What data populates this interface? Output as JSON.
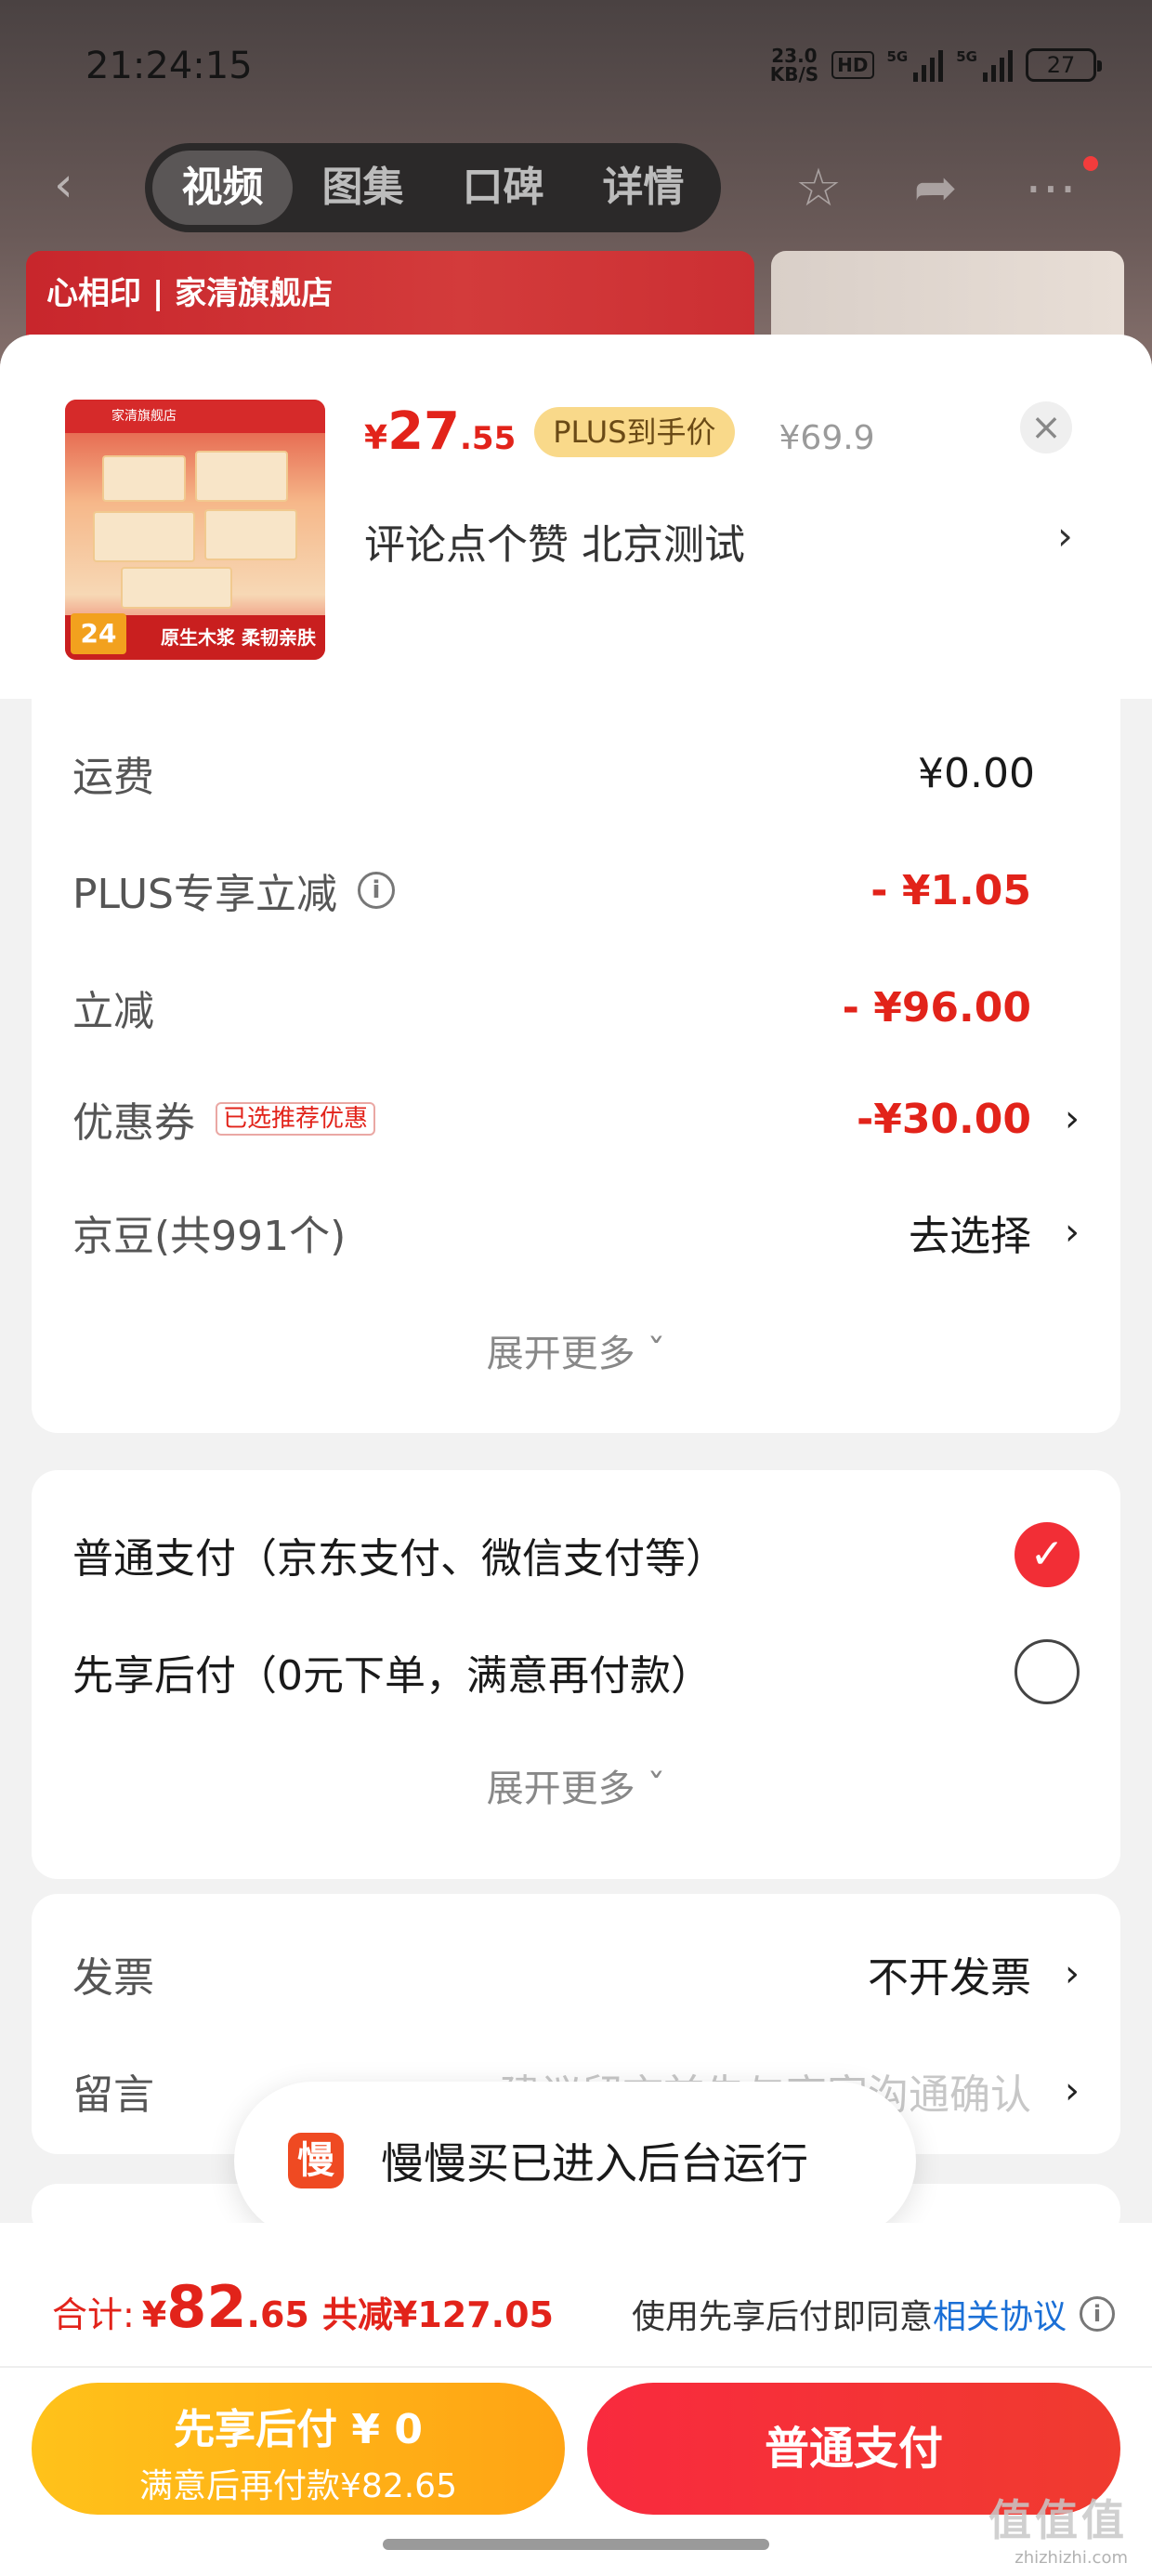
{
  "status_bar": {
    "time": "21:24:15",
    "net_speed_value": "23.0",
    "net_speed_unit": "KB/S",
    "hd_badge": "HD",
    "signal_1_label": "5G",
    "signal_2_label": "5G",
    "battery_level": "27"
  },
  "nav": {
    "tabs": [
      {
        "label": "视频",
        "active": true
      },
      {
        "label": "图集",
        "active": false
      },
      {
        "label": "口碑",
        "active": false
      },
      {
        "label": "详情",
        "active": false
      }
    ],
    "icons": [
      "back-icon",
      "star-icon",
      "share-icon",
      "more-icon"
    ]
  },
  "banner": {
    "brand": "心相印 | 家清旗舰店"
  },
  "product": {
    "image_top_text": "家清旗舰店",
    "image_bottom_text": "原生木浆 柔韧亲肤",
    "image_badge": "24",
    "price_symbol": "¥",
    "price_integer": "27",
    "price_decimal": ".55",
    "plus_badge": "PLUS到手价",
    "original_price": "¥69.9",
    "title": "评论点个赞  北京测试",
    "title_chevron": "›",
    "close_glyph": "×"
  },
  "fees": {
    "shipping": {
      "label": "运费",
      "value": "¥0.00"
    },
    "plus_discount": {
      "label": "PLUS专享立减",
      "value": "- ¥1.05",
      "info_glyph": "i"
    },
    "instant_discount": {
      "label": "立减",
      "value": "- ¥96.00"
    },
    "coupon": {
      "label": "优惠券",
      "tag": "已选推荐优惠",
      "value": "-¥30.00",
      "chevron": "›"
    },
    "jingdou": {
      "label": "京豆(共991个)",
      "value": "去选择",
      "chevron": "›"
    },
    "expand": "展开更多 ˇ"
  },
  "payment": {
    "normal": {
      "label": "普通支付（京东支付、微信支付等）",
      "checked": true,
      "check_glyph": "✓"
    },
    "later": {
      "label": "先享后付（0元下单，满意再付款）",
      "checked": false
    },
    "expand": "展开更多 ˇ"
  },
  "extras": {
    "invoice": {
      "label": "发票",
      "value": "不开发票",
      "chevron": "›"
    },
    "message": {
      "label": "留言",
      "placeholder": "建议留言前先与商家沟通确认",
      "chevron": "›"
    }
  },
  "toast": {
    "icon_text": "慢",
    "message": "慢慢买已进入后台运行"
  },
  "footer": {
    "total_label": "合计:",
    "total_symbol": "¥",
    "total_integer": "82",
    "total_decimal": ".65",
    "total_saved": "共减¥127.05",
    "agree_text": "使用先享后付即同意",
    "agree_link": "相关协议",
    "agree_info_glyph": "i",
    "later_button_line1": "先享后付 ¥ 0",
    "later_button_line2": "满意后再付款¥82.65",
    "pay_button": "普通支付"
  },
  "watermark": {
    "line1": "值值值",
    "line2": "zhizhizhi.com"
  },
  "colors": {
    "accent_red": "#e2231a",
    "pay_button": "#f92a3e",
    "later_button": "#ffb516",
    "link_blue": "#1a6fd6",
    "plus_badge_bg": "#f9d98a"
  }
}
